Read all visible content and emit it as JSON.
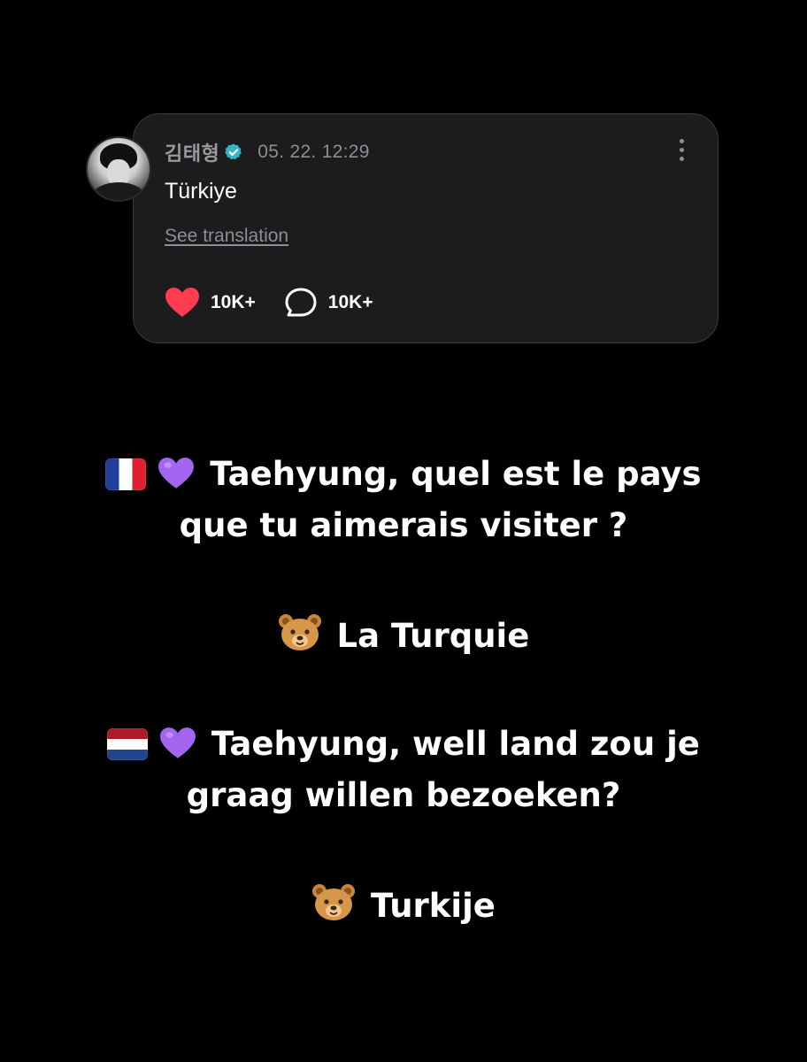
{
  "post": {
    "author": "김태형",
    "timestamp": "05. 22. 12:29",
    "text": "Türkiye",
    "translate_link": "See translation",
    "likes": "10K+",
    "comments": "10K+",
    "avatar_icon": "profile-photo",
    "verified_icon": "verified-badge-icon",
    "accent_color": "#30b6c4",
    "heart_color": "#ff3b4f"
  },
  "caption": {
    "fr_question_line1": "Taehyung, quel est le pays",
    "fr_question_line2": "que tu aimerais visiter ?",
    "fr_answer": "La Turquie",
    "nl_question_line1": "Taehyung, well land zou je",
    "nl_question_line2": "graag willen bezoeken?",
    "nl_answer": "Turkije",
    "icons": [
      "france-flag-icon",
      "purple-heart-icon",
      "bear-face-icon",
      "netherlands-flag-icon"
    ]
  }
}
